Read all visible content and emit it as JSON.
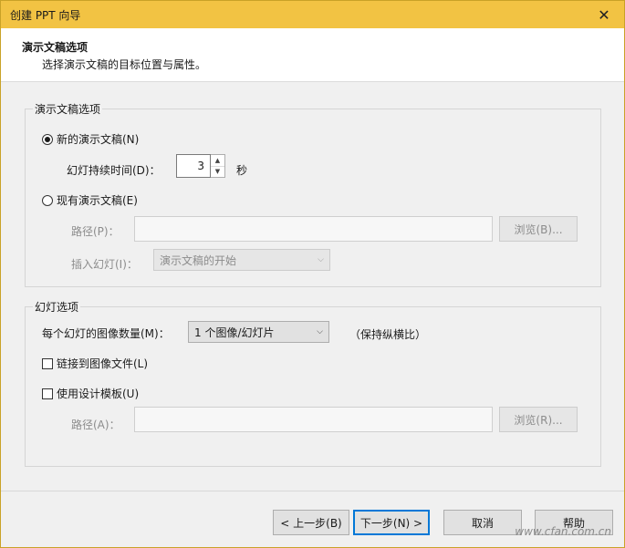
{
  "window": {
    "title": "创建 PPT 向导"
  },
  "header": {
    "title": "演示文稿选项",
    "subtitle": "选择演示文稿的目标位置与属性。"
  },
  "presentation_group": {
    "legend": "演示文稿选项",
    "new_radio_label": "新的演示文稿(N)",
    "duration_label": "幻灯持续时间(D)：",
    "duration_value": "3",
    "duration_unit": "秒",
    "existing_radio_label": "现有演示文稿(E)",
    "path_label": "路径(P)：",
    "path_value": "",
    "browse_label": "浏览(B)...",
    "insert_label": "插入幻灯(I)：",
    "insert_value": "演示文稿的开始"
  },
  "slide_group": {
    "legend": "幻灯选项",
    "images_per_slide_label": "每个幻灯的图像数量(M)：",
    "images_per_slide_value": "1 个图像/幻灯片",
    "aspect_note": "（保持纵横比）",
    "link_checkbox_label": "链接到图像文件(L)",
    "template_checkbox_label": "使用设计模板(U)",
    "path_label": "路径(A)：",
    "path_value": "",
    "browse_label": "浏览(R)..."
  },
  "footer": {
    "back_label": "< 上一步(B)",
    "next_label": "下一步(N) >",
    "cancel_label": "取消",
    "help_label": "帮助"
  },
  "watermark": "www.cfan.com.cn"
}
